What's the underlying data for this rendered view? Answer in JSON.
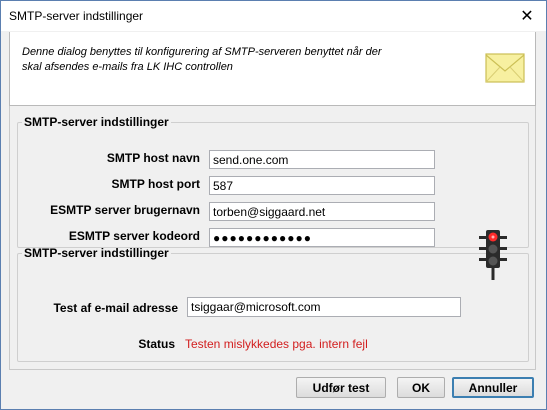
{
  "window": {
    "title": "SMTP-server indstillinger",
    "close_label": "✕"
  },
  "intro": {
    "text": "Denne dialog benyttes til konfigurering af SMTP-serveren benyttet når der skal afsendes e-mails fra LK IHC controllen",
    "icon": "envelope-icon"
  },
  "server_group": {
    "legend": "SMTP-server indstillinger",
    "host_label": "SMTP host navn",
    "host_value": "send.one.com",
    "port_label": "SMTP host port",
    "port_value": "587",
    "user_label": "ESMTP server brugernavn",
    "user_value": "torben@siggaard.net",
    "password_label": "ESMTP server kodeord",
    "password_value": "●●●●●●●●●●●●"
  },
  "test_group": {
    "legend": "SMTP-server indstillinger",
    "email_label": "Test af e-mail adresse",
    "email_value": "tsiggaar@microsoft.com",
    "status_label": "Status",
    "status_value": "Testen mislykkedes pga. intern fejl",
    "status_color": "#d21e1e",
    "indicator_icon": "traffic-light-red-icon"
  },
  "buttons": {
    "test": "Udfør test",
    "ok": "OK",
    "cancel": "Annuller"
  }
}
